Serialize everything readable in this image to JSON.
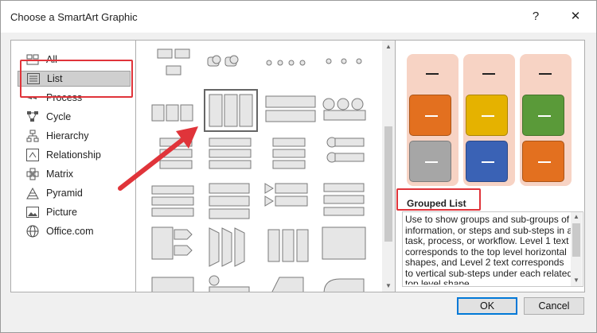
{
  "window": {
    "title": "Choose a SmartArt Graphic",
    "help_glyph": "?",
    "close_glyph": "✕"
  },
  "categories": [
    {
      "label": "All",
      "icon": "all-icon"
    },
    {
      "label": "List",
      "icon": "list-icon",
      "selected": true
    },
    {
      "label": "Process",
      "icon": "process-icon"
    },
    {
      "label": "Cycle",
      "icon": "cycle-icon"
    },
    {
      "label": "Hierarchy",
      "icon": "hierarchy-icon"
    },
    {
      "label": "Relationship",
      "icon": "relationship-icon"
    },
    {
      "label": "Matrix",
      "icon": "matrix-icon"
    },
    {
      "label": "Pyramid",
      "icon": "pyramid-icon"
    },
    {
      "label": "Picture",
      "icon": "picture-icon"
    },
    {
      "label": "Office.com",
      "icon": "globe-icon"
    }
  ],
  "gallery": {
    "selected_layout": "Grouped List",
    "annotation_arrow_color": "#e0343a"
  },
  "preview": {
    "name": "Grouped List",
    "description": "Use to show groups and sub-groups of information, or steps and sub-steps in a task, process, or workflow. Level 1 text corresponds to the top level horizontal shapes, and Level 2 text corresponds to vertical sub-steps under each related top level shape.",
    "column_color": "#f7d3c4",
    "block_colors": [
      [
        "#e3701f",
        "#a6a6a6"
      ],
      [
        "#e5b200",
        "#3a62b5"
      ],
      [
        "#5a9a39",
        "#e3701f"
      ]
    ]
  },
  "buttons": {
    "ok": "OK",
    "cancel": "Cancel"
  },
  "highlight_color": "#e0343a"
}
